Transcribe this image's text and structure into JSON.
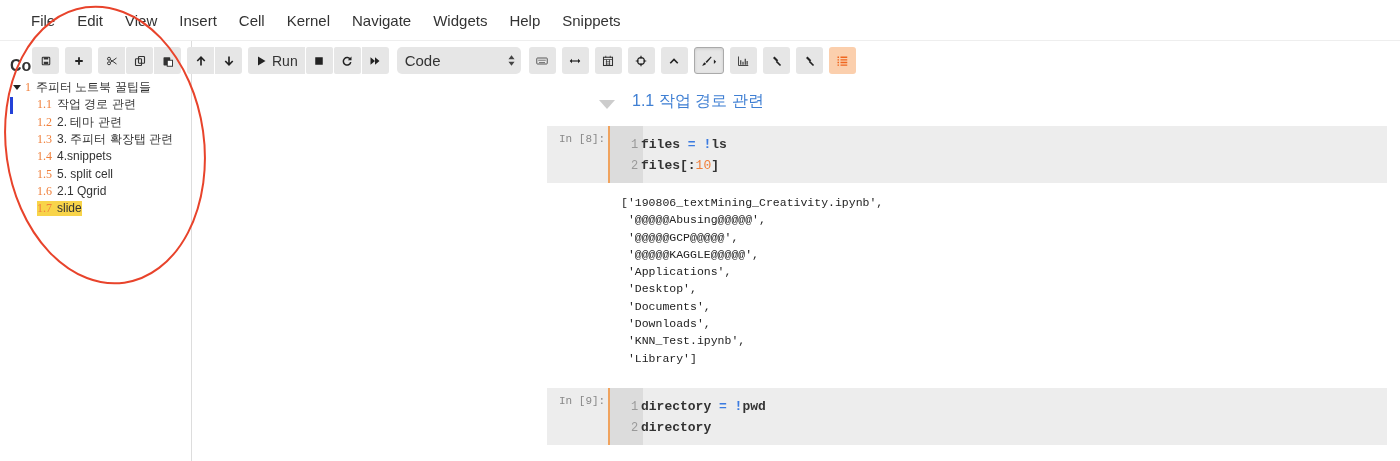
{
  "menu": [
    "File",
    "Edit",
    "View",
    "Insert",
    "Cell",
    "Kernel",
    "Navigate",
    "Widgets",
    "Help",
    "Snippets"
  ],
  "toolbar": [
    {
      "group": [
        {
          "pressed": false
        }
      ]
    },
    {
      "group": [
        {
          "pressed": false
        }
      ]
    },
    {
      "group": [
        {
          "pressed": false
        },
        {
          "pressed": false
        },
        {
          "pressed": false
        }
      ]
    },
    {
      "group": [
        {
          "pressed": false
        },
        {
          "pressed": false
        }
      ]
    },
    {
      "group": [
        {
          "label": "Run",
          "pressed": false
        },
        {
          "pressed": false
        },
        {
          "pressed": false
        },
        {
          "pressed": false
        }
      ]
    },
    {
      "select": "Code"
    },
    {
      "group": [
        {
          "pressed": false
        }
      ]
    },
    {
      "group": [
        {
          "pressed": false
        }
      ]
    },
    {
      "group": [
        {
          "pressed": false
        }
      ]
    },
    {
      "group": [
        {
          "pressed": false
        }
      ]
    },
    {
      "group": [
        {
          "pressed": false
        }
      ]
    },
    {
      "group": [
        {
          "pressed": true
        }
      ]
    },
    {
      "group": [
        {
          "pressed": false
        }
      ]
    },
    {
      "group": [
        {
          "pressed": false
        }
      ]
    },
    {
      "group": [
        {
          "pressed": false
        }
      ]
    },
    {
      "group": [
        {
          "pressed": true
        }
      ]
    }
  ],
  "toc": {
    "heading": "Co",
    "items": [
      {
        "number": "1",
        "title": "주피터 노트북 꿀팁들",
        "expanded": true,
        "children": [
          {
            "number": "1.1",
            "title": "작업 경로 관련",
            "current": true,
            "highlighted": false
          },
          {
            "number": "1.2",
            "title": "2. 테마 관련",
            "current": false,
            "highlighted": false
          },
          {
            "number": "1.3",
            "title": "3. 주피터 확장탭 관련",
            "current": false,
            "highlighted": false
          },
          {
            "number": "1.4",
            "title": "4.snippets",
            "current": false,
            "highlighted": false
          },
          {
            "number": "1.5",
            "title": "5. split cell",
            "current": false,
            "highlighted": false
          },
          {
            "number": "1.6",
            "title": "2.1 Qgrid",
            "current": false,
            "highlighted": false
          },
          {
            "number": "1.7",
            "title": "slide",
            "current": false,
            "highlighted": true
          }
        ]
      }
    ]
  },
  "notebook": {
    "heading": {
      "number": "1.1",
      "title": "작업 경로 관련",
      "expanded": true
    },
    "cells": [
      {
        "prompt": "In [8]:",
        "lines": [
          {
            "number": "1",
            "tokens": [
              {
                "kind": "plain",
                "text": "files "
              },
              {
                "kind": "op",
                "text": "= !"
              },
              {
                "kind": "plain",
                "text": "ls"
              }
            ]
          },
          {
            "number": "2",
            "tokens": [
              {
                "kind": "plain",
                "text": "files[:"
              },
              {
                "kind": "num",
                "text": "10"
              },
              {
                "kind": "plain",
                "text": "]"
              }
            ]
          }
        ],
        "output": "['190806_textMining_Creativity.ipynb',\n '@@@@@Abusing@@@@@',\n '@@@@@GCP@@@@@',\n '@@@@@KAGGLE@@@@@',\n 'Applications',\n 'Desktop',\n 'Documents',\n 'Downloads',\n 'KNN_Test.ipynb',\n 'Library']"
      },
      {
        "prompt": "In [9]:",
        "lines": [
          {
            "number": "1",
            "tokens": [
              {
                "kind": "plain",
                "text": "directory "
              },
              {
                "kind": "op",
                "text": "= !"
              },
              {
                "kind": "plain",
                "text": "pwd"
              }
            ]
          },
          {
            "number": "2",
            "tokens": [
              {
                "kind": "plain",
                "text": "directory"
              }
            ]
          }
        ]
      }
    ]
  }
}
